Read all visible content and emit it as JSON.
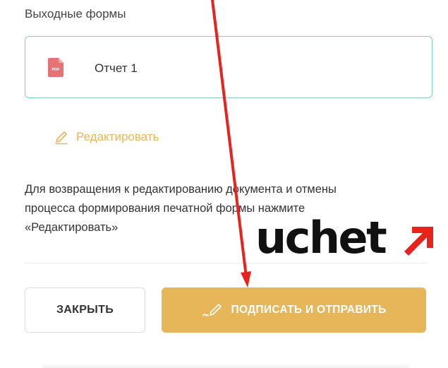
{
  "section": {
    "title": "Выходные формы"
  },
  "file": {
    "name": "Отчет 1",
    "icon": "pdf-file-icon",
    "icon_label": "PDF"
  },
  "edit": {
    "label": "Редактировать",
    "icon": "pencil-icon"
  },
  "info": {
    "lines": [
      "Для возвращения к редактированию документа и отмены",
      "процесса формирования печатной формы нажмите",
      "«Редактировать»"
    ]
  },
  "buttons": {
    "close_label": "ЗАКРЫТЬ",
    "sign_label": "ПОДПИСАТЬ И ОТПРАВИТЬ",
    "sign_icon": "signature-pen-icon"
  },
  "logo": {
    "text": "uchet",
    "arrow_icon": "red-arrow-icon"
  },
  "colors": {
    "accent": "#e6b659",
    "link": "#eab55a",
    "card_border": "#7fd0c0",
    "pdf_icon": "#e57373",
    "annotation_arrow": "#e8231d"
  }
}
